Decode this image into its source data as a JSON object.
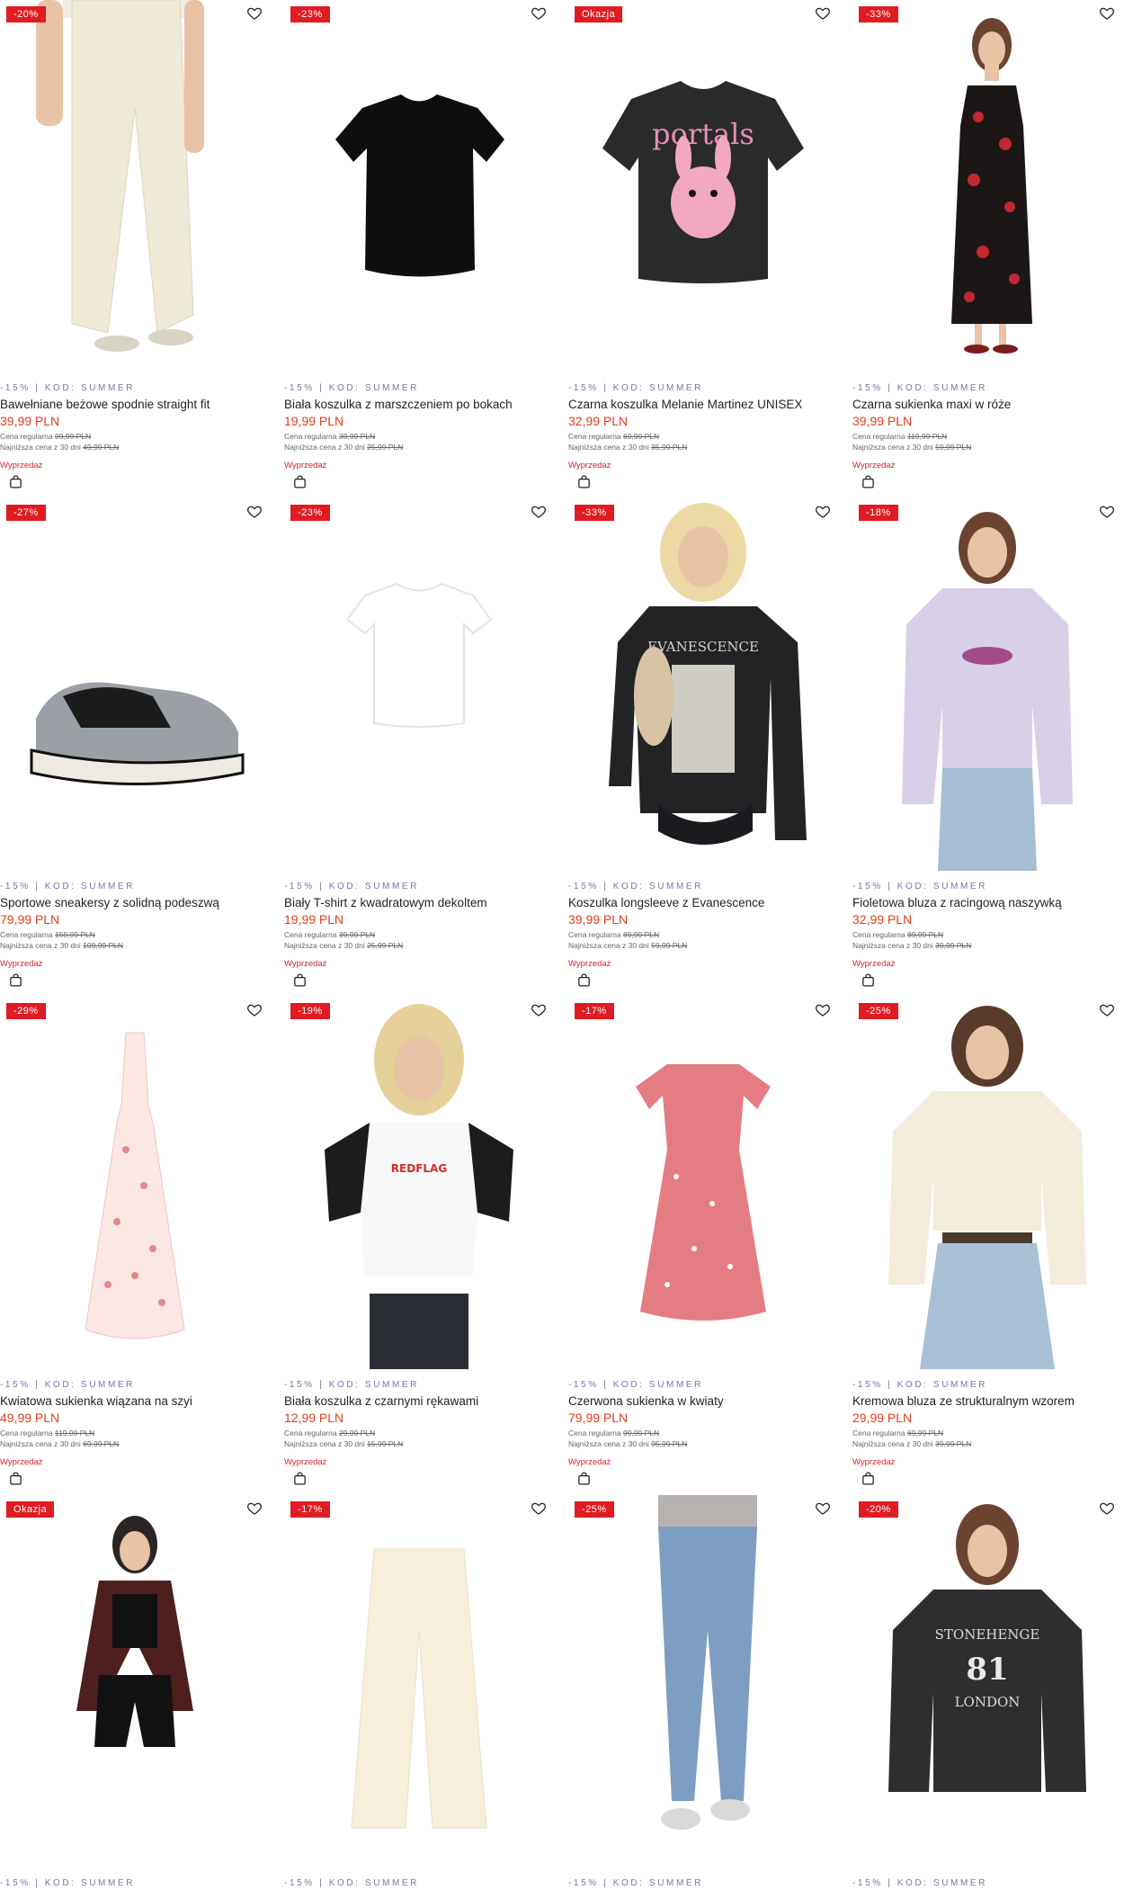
{
  "colors": {
    "accent_red": "#e11b22",
    "price_red": "#e23d1a",
    "promo_blue": "#6f7aa6",
    "sale_red": "#d2232a"
  },
  "icons": {
    "favorite": "heart-icon",
    "cart": "shopping-bag-icon"
  },
  "common": {
    "promo_code": "-15% | KOD: SUMMER",
    "regular_label": "Cena regularna",
    "lowest_label": "Najniższa cena z 30 dni",
    "sale_label": "Wyprzedaż"
  },
  "products": [
    {
      "badge": "-20%",
      "name": "Bawełniane beżowe spodnie straight fit",
      "price": "39,99 PLN",
      "regular": "99,99 PLN",
      "lowest": "49,99 PLN",
      "image": "beige-trousers"
    },
    {
      "badge": "-23%",
      "name": "Biała koszulka z marszczeniem po bokach",
      "price": "19,99 PLN",
      "regular": "39,99 PLN",
      "lowest": "25,99 PLN",
      "image": "black-tee"
    },
    {
      "badge": "Okazja",
      "name": "Czarna koszulka Melanie Martinez UNISEX",
      "price": "32,99 PLN",
      "regular": "69,99 PLN",
      "lowest": "35,99 PLN",
      "image": "graphic-tee"
    },
    {
      "badge": "-33%",
      "name": "Czarna sukienka maxi w róże",
      "price": "39,99 PLN",
      "regular": "119,99 PLN",
      "lowest": "59,99 PLN",
      "image": "rose-dress"
    },
    {
      "badge": "-27%",
      "name": "Sportowe sneakersy z solidną podeszwą",
      "price": "79,99 PLN",
      "regular": "159,99 PLN",
      "lowest": "109,99 PLN",
      "image": "sneakers"
    },
    {
      "badge": "-23%",
      "name": "Biały T-shirt z kwadratowym dekoltem",
      "price": "19,99 PLN",
      "regular": "39,99 PLN",
      "lowest": "25,99 PLN",
      "image": "white-top"
    },
    {
      "badge": "-33%",
      "name": "Koszulka longsleeve z Evanescence",
      "price": "39,99 PLN",
      "regular": "89,99 PLN",
      "lowest": "59,99 PLN",
      "image": "band-tee"
    },
    {
      "badge": "-18%",
      "name": "Fioletowa bluza z racingową naszywką",
      "price": "32,99 PLN",
      "regular": "89,99 PLN",
      "lowest": "39,99 PLN",
      "image": "lilac-hoodie"
    },
    {
      "badge": "-29%",
      "name": "Kwiatowa sukienka wiązana na szyi",
      "price": "49,99 PLN",
      "regular": "119,99 PLN",
      "lowest": "69,99 PLN",
      "image": "floral-dress"
    },
    {
      "badge": "-19%",
      "name": "Biała koszulka z czarnymi rękawami",
      "price": "12,99 PLN",
      "regular": "29,99 PLN",
      "lowest": "15,99 PLN",
      "image": "raglan-tee"
    },
    {
      "badge": "-17%",
      "name": "Czerwona sukienka w kwiaty",
      "price": "79,99 PLN",
      "regular": "99,99 PLN",
      "lowest": "95,99 PLN",
      "image": "red-dress"
    },
    {
      "badge": "-25%",
      "name": "Kremowa bluza ze strukturalnym wzorem",
      "price": "29,99 PLN",
      "regular": "69,99 PLN",
      "lowest": "39,99 PLN",
      "image": "cream-sweater"
    },
    {
      "badge": "Okazja",
      "name": "",
      "price": "",
      "regular": "",
      "lowest": "",
      "image": "leather-jacket"
    },
    {
      "badge": "-17%",
      "name": "",
      "price": "",
      "regular": "",
      "lowest": "",
      "image": "cream-trousers"
    },
    {
      "badge": "-25%",
      "name": "",
      "price": "",
      "regular": "",
      "lowest": "",
      "image": "skinny-jeans"
    },
    {
      "badge": "-20%",
      "name": "",
      "price": "",
      "regular": "",
      "lowest": "",
      "image": "stonehenge-sweatshirt"
    }
  ],
  "graphics": {
    "graphic_tee_text": "portals",
    "band_tee_text": "EVANESCENCE",
    "raglan_text": "REDFLAG",
    "sweatshirt_text_1": "STONEHENGE",
    "sweatshirt_text_2": "81",
    "sweatshirt_text_3": "LONDON"
  }
}
